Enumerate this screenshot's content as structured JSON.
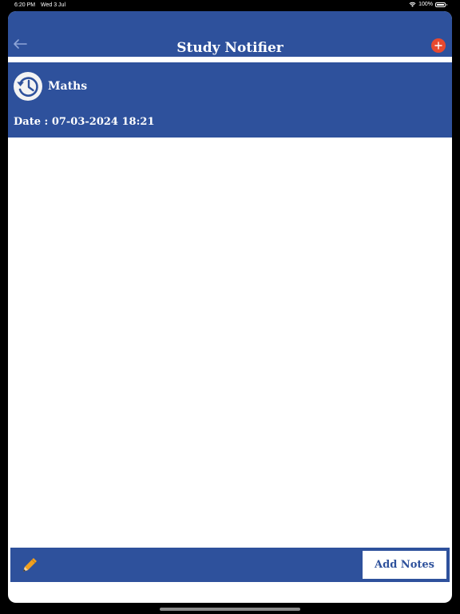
{
  "status_bar": {
    "time": "6:20 PM",
    "date": "Wed 3 Jul",
    "battery": "100%",
    "icons": [
      "wifi-icon",
      "battery-icon"
    ]
  },
  "nav": {
    "title": "Study Notifier",
    "back_icon": "arrow-left-icon",
    "add_icon": "plus-circle-icon"
  },
  "subject": {
    "icon": "history-clock-icon",
    "name": "Maths",
    "date_text": "Date : 07-03-2024 18:21"
  },
  "bottom_bar": {
    "edit_icon": "pencil-icon",
    "add_notes_label": "Add Notes"
  },
  "colors": {
    "primary": "#2e519c",
    "accent": "#e8492f",
    "pencil": "#f0a020",
    "background": "#ffffff"
  }
}
